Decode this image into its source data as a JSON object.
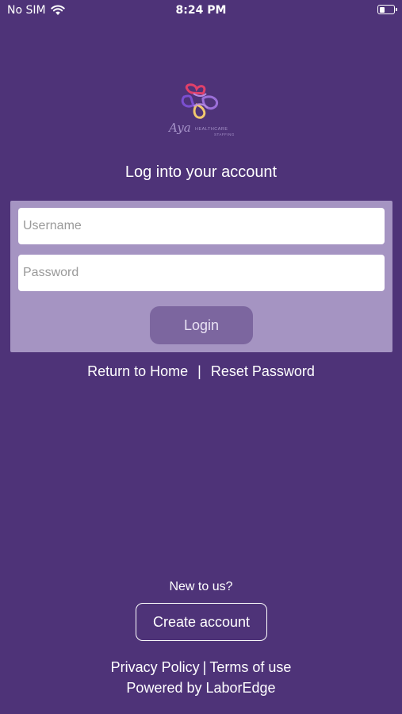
{
  "status_bar": {
    "carrier": "No SIM",
    "time": "8:24 PM",
    "battery_level": 0.4,
    "icons": [
      "wifi-icon",
      "battery-icon"
    ]
  },
  "logo": {
    "script": "Aya",
    "word1": "HEALTHCARE",
    "word2": "STAFFING",
    "colors": [
      "#e0406a",
      "#7b4fd0",
      "#f2c86e",
      "#a693c9"
    ]
  },
  "page_title": "Log into your account",
  "form": {
    "username_placeholder": "Username",
    "password_placeholder": "Password",
    "login_label": "Login"
  },
  "links": {
    "return_home": "Return to Home",
    "separator": "|",
    "reset_password": "Reset Password"
  },
  "signup": {
    "prompt": "New to us?",
    "create_label": "Create account"
  },
  "footer": {
    "privacy": "Privacy Policy",
    "separator": "|",
    "terms": "Terms of use",
    "powered": "Powered by LaborEdge"
  },
  "colors": {
    "background": "#4e3378",
    "card": "#a594c2",
    "login_button": "#7c669f"
  }
}
